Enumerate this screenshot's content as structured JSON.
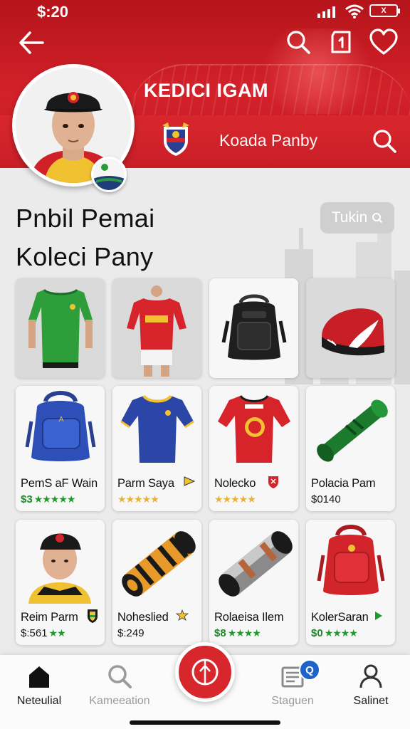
{
  "status_bar": {
    "time": "$:20",
    "battery_label": "X"
  },
  "header": {
    "brand_title": "KEDICI IGAM",
    "search_text": "Koada Panby"
  },
  "section": {
    "title_line1": "Pnbil Pemai",
    "title_line2": "Koleci Pany",
    "filter_label": "Tukin",
    "filter_icon": "search-icon"
  },
  "top_row": [
    {
      "item": "green-jersey"
    },
    {
      "item": "red-jersey-player"
    },
    {
      "item": "black-backpack"
    },
    {
      "item": "red-cap"
    }
  ],
  "products": [
    {
      "name": "PemS aF Wain",
      "price": "$3",
      "stars": "★★★★★",
      "item": "blue-backpack"
    },
    {
      "name": "Parm Saya",
      "price": "",
      "stars": "★★★★★",
      "item": "blue-jersey",
      "tag": "flag-icon"
    },
    {
      "name": "Nolecko",
      "price": "",
      "stars": "★★★★★",
      "item": "red-jersey",
      "tag": "shield-icon"
    },
    {
      "name": "Polacia Pam",
      "price": "$0140",
      "stars": "",
      "item": "green-scarf-roll"
    },
    {
      "name": "Reim Parm",
      "price": "$:561",
      "stars": "★★",
      "item": "player-portrait",
      "tag": "crest-icon"
    },
    {
      "name": "Noheslied",
      "price": "$:249",
      "stars": "",
      "item": "orange-roll",
      "tag": "star-tag-icon"
    },
    {
      "name": "Rolaeisa Ilem",
      "price": "$8",
      "stars": "★★★★",
      "item": "steel-roll"
    },
    {
      "name": "KolerSaran",
      "price": "$0",
      "stars": "★★★★",
      "item": "red-backpack",
      "tag": "play-icon"
    }
  ],
  "nav": {
    "items": [
      {
        "label": "Neteulial",
        "icon": "home-icon"
      },
      {
        "label": "Kameeation",
        "icon": "search-icon"
      },
      {
        "label": "Staguen",
        "icon": "document-icon",
        "badge": "Q"
      },
      {
        "label": "Salinet",
        "icon": "profile-icon"
      }
    ],
    "center_icon": "ball-icon"
  },
  "colors": {
    "primary": "#d3212a",
    "accent_green": "#1f9a2e",
    "badge_blue": "#1d63c9"
  }
}
